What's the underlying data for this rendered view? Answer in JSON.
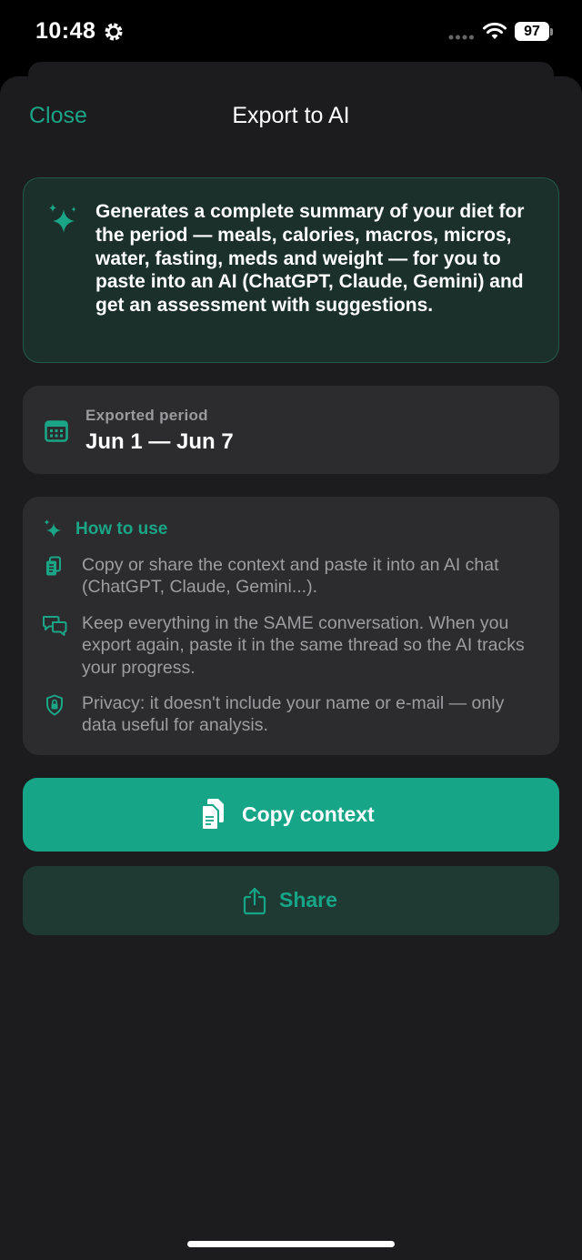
{
  "status_bar": {
    "time": "10:48",
    "battery": "97",
    "icons": [
      "gear-icon",
      "signal-dots-icon",
      "wifi-icon",
      "battery-icon"
    ]
  },
  "header": {
    "close_label": "Close",
    "title": "Export to AI"
  },
  "info": {
    "icon": "sparkles-icon",
    "text": "Generates a complete summary of your diet for the period — meals, calories, macros, micros, water, fasting, meds and weight — for you to paste into an AI (ChatGPT, Claude, Gemini) and get an assessment with suggestions."
  },
  "period": {
    "icon": "calendar-icon",
    "label": "Exported period",
    "value": "Jun 1 — Jun 7"
  },
  "how_to": {
    "icon": "sparkles-icon",
    "title": "How to use",
    "items": [
      {
        "icon": "copy-icon",
        "text": "Copy or share the context and paste it into an AI chat (ChatGPT, Claude, Gemini...)."
      },
      {
        "icon": "chat-bubbles-icon",
        "text": "Keep everything in the SAME conversation. When you export again, paste it in the same thread so the AI tracks your progress."
      },
      {
        "icon": "lock-shield-icon",
        "text": "Privacy: it doesn't include your name or e-mail — only data useful for analysis."
      }
    ]
  },
  "actions": {
    "copy_label": "Copy context",
    "share_label": "Share"
  },
  "colors": {
    "accent": "#17a588",
    "sheet_bg": "#1c1c1e",
    "card_bg": "#2c2c2e",
    "info_bg": "#1b302b",
    "share_bg": "#1e3a33"
  }
}
